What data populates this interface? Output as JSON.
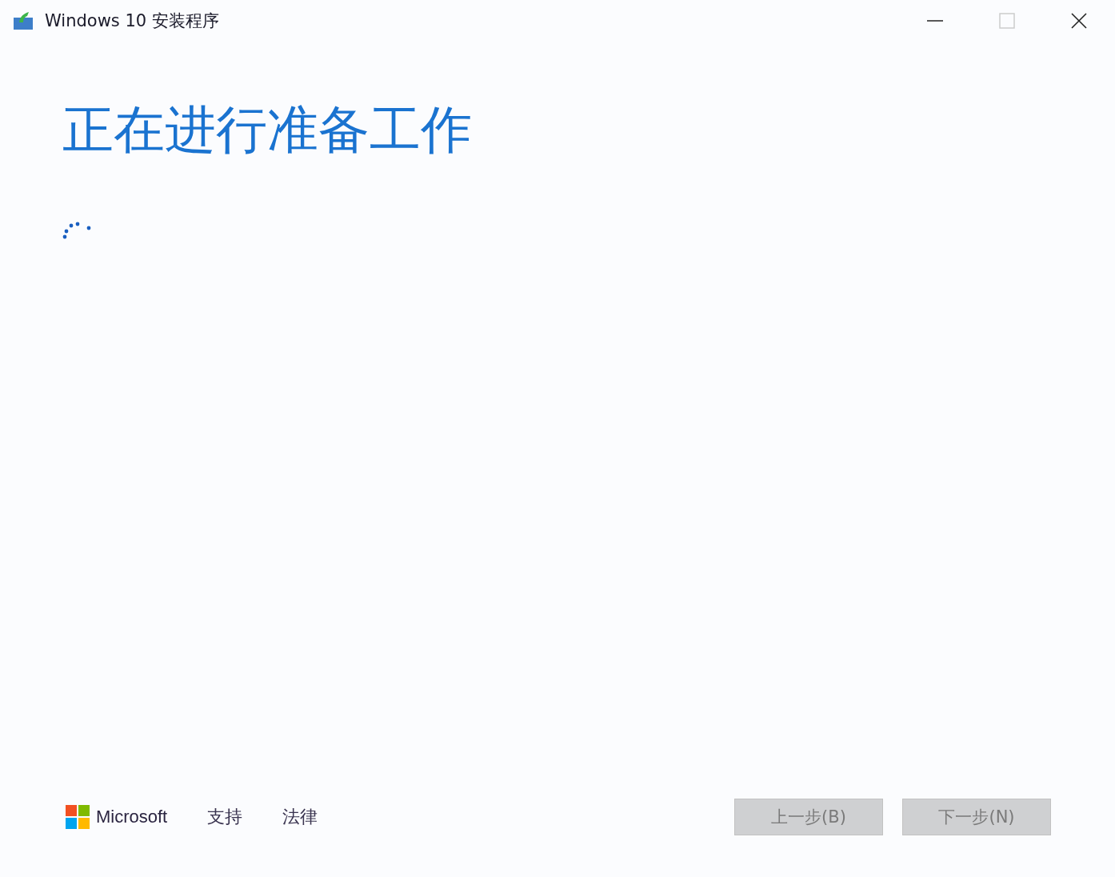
{
  "window": {
    "title": "Windows 10 安装程序"
  },
  "heading": "正在进行准备工作",
  "footer": {
    "brand": "Microsoft",
    "links": [
      "支持",
      "法律"
    ]
  },
  "buttons": [
    {
      "label": "上一步(B)",
      "disabled": true
    },
    {
      "label": "下一步(N)",
      "disabled": true
    }
  ]
}
